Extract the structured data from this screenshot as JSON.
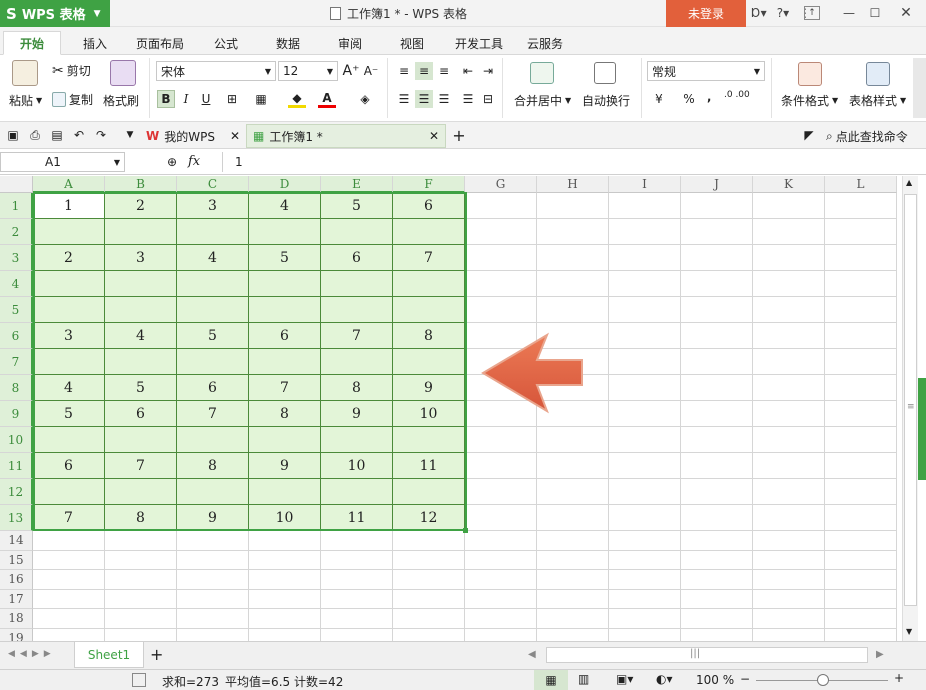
{
  "app": {
    "name": "WPS 表格",
    "logo": "S",
    "accent": "#3fa244"
  },
  "title": {
    "doc": "工作簿1 * - WPS 表格",
    "login": "未登录"
  },
  "menu": {
    "tabs": [
      "开始",
      "插入",
      "页面布局",
      "公式",
      "数据",
      "审阅",
      "视图",
      "开发工具",
      "云服务"
    ]
  },
  "ribbon": {
    "paste": "粘贴",
    "cut": "剪切",
    "copy": "复制",
    "format_painter": "格式刷",
    "font": "宋体",
    "size": "12",
    "bold": "B",
    "italic": "I",
    "underline": "U",
    "merge": "合并居中",
    "wrap": "自动换行",
    "number_format": "常规",
    "percent": "%",
    "comma": "‚",
    "inc_dec": ".0 .00",
    "cond_format": "条件格式",
    "table_style": "表格样式"
  },
  "docbar": {
    "tabs": [
      "我的WPS",
      "工作簿1 *"
    ],
    "find": "点此查找命令"
  },
  "formula": {
    "name_box": "A1",
    "fx": "fx",
    "value": "1"
  },
  "grid": {
    "columns": [
      "A",
      "B",
      "C",
      "D",
      "E",
      "F",
      "G",
      "H",
      "I",
      "J",
      "K",
      "L"
    ],
    "rows": [
      "1",
      "2",
      "3",
      "4",
      "5",
      "6",
      "7",
      "8",
      "9",
      "10",
      "11",
      "12",
      "13",
      "14",
      "15",
      "16",
      "17",
      "18",
      "19"
    ],
    "values": [
      [
        "1",
        "2",
        "3",
        "4",
        "5",
        "6"
      ],
      [
        "",
        "",
        "",
        "",
        "",
        ""
      ],
      [
        "2",
        "3",
        "4",
        "5",
        "6",
        "7"
      ],
      [
        "",
        "",
        "",
        "",
        "",
        ""
      ],
      [
        "",
        "",
        "",
        "",
        "",
        ""
      ],
      [
        "3",
        "4",
        "5",
        "6",
        "7",
        "8"
      ],
      [
        "",
        "",
        "",
        "",
        "",
        ""
      ],
      [
        "4",
        "5",
        "6",
        "7",
        "8",
        "9"
      ],
      [
        "5",
        "6",
        "7",
        "8",
        "9",
        "10"
      ],
      [
        "",
        "",
        "",
        "",
        "",
        ""
      ],
      [
        "6",
        "7",
        "8",
        "9",
        "10",
        "11"
      ],
      [
        "",
        "",
        "",
        "",
        "",
        ""
      ],
      [
        "7",
        "8",
        "9",
        "10",
        "11",
        "12"
      ]
    ]
  },
  "arrow_color": "#e0603e",
  "sheets": [
    "Sheet1"
  ],
  "status": {
    "sum": "求和=273",
    "avg": "平均值=6.5",
    "count": "计数=42",
    "zoom": "100 %"
  }
}
